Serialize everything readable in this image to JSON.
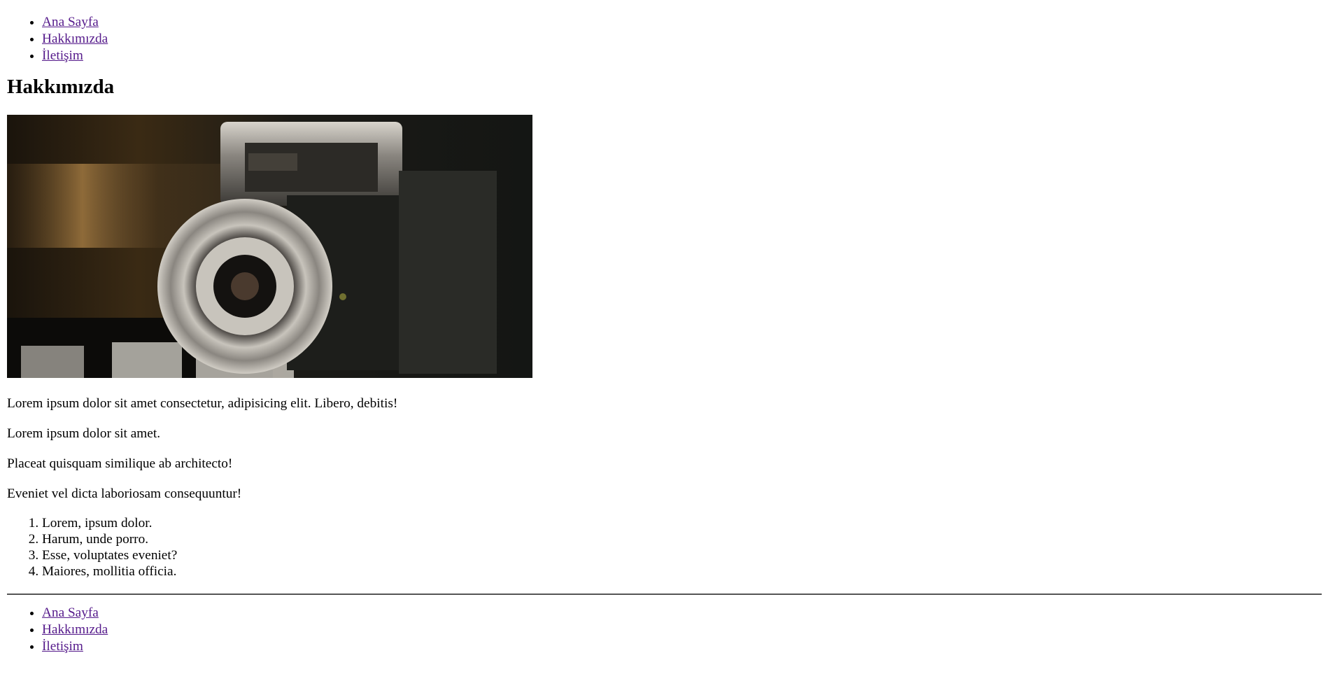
{
  "nav_top": [
    {
      "label": "Ana Sayfa"
    },
    {
      "label": "Hakkımızda"
    },
    {
      "label": "İletişim"
    }
  ],
  "page_title": "Hakkımızda",
  "paragraphs": [
    "Lorem ipsum dolor sit amet consectetur, adipisicing elit. Libero, debitis!",
    "Lorem ipsum dolor sit amet.",
    "Placeat quisquam similique ab architecto!",
    "Eveniet vel dicta laboriosam consequuntur!"
  ],
  "ordered_list": [
    "Lorem, ipsum dolor.",
    "Harum, unde porro.",
    "Esse, voluptates eveniet?",
    "Maiores, mollitia officia."
  ],
  "nav_bottom": [
    {
      "label": "Ana Sayfa"
    },
    {
      "label": "Hakkımızda"
    },
    {
      "label": "İletişim"
    }
  ],
  "colors": {
    "link_visited": "#551a8b",
    "text": "#000000",
    "rule": "#555555"
  },
  "image": {
    "subject": "vintage-camera-photo"
  }
}
